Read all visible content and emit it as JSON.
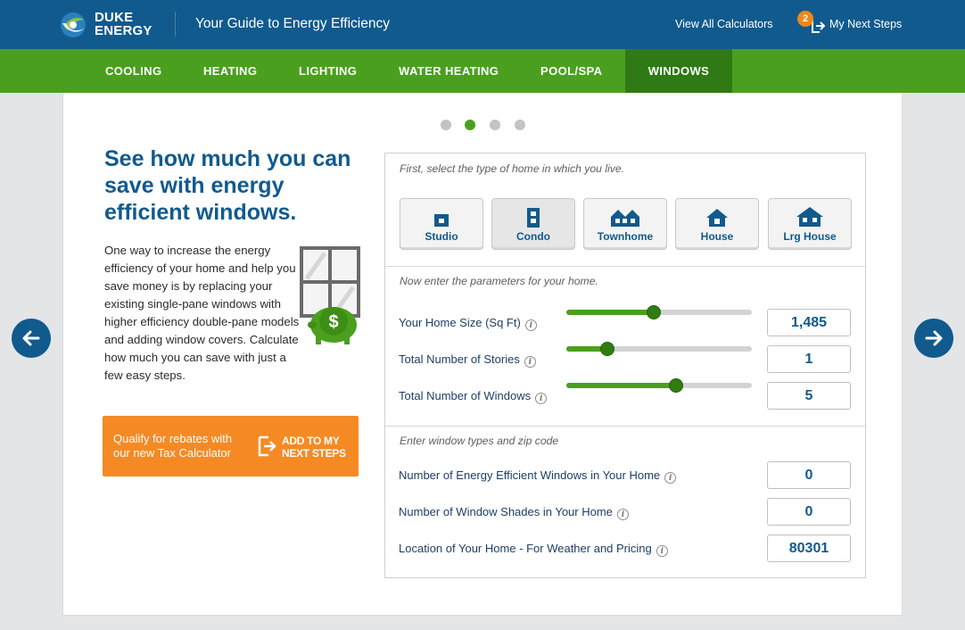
{
  "header": {
    "brand_line1": "DUKE",
    "brand_line2": "ENERGY",
    "title": "Your Guide to Energy Efficiency",
    "view_all": "View All Calculators",
    "next_steps_count": "2",
    "next_steps_label": "My Next Steps"
  },
  "nav": {
    "items": [
      "COOLING",
      "HEATING",
      "LIGHTING",
      "WATER HEATING",
      "POOL/SPA",
      "WINDOWS"
    ],
    "active": "WINDOWS"
  },
  "carousel": {
    "total": 4,
    "current": 2
  },
  "intro": {
    "headline": "See how much you can save with energy efficient windows.",
    "body": "One way to increase the energy efficiency of your home and help you save money is by replacing your existing single-pane windows with higher efficiency double-pane models and adding window covers. Calculate how much you can save with just a few easy steps."
  },
  "cta": {
    "text": "Qualify for rebates with our new Tax Calculator",
    "action": "ADD TO MY NEXT STEPS"
  },
  "calculator": {
    "step1_title": "First, select the type of home in which you live.",
    "home_types": [
      "Studio",
      "Condo",
      "Townhome",
      "House",
      "Lrg House"
    ],
    "selected_home": "Condo",
    "step2_title": "Now enter the parameters for your home.",
    "params": [
      {
        "label": "Your Home Size (Sq Ft)",
        "value": "1,485",
        "fill": 0.47
      },
      {
        "label": "Total Number of Stories",
        "value": "1",
        "fill": 0.22
      },
      {
        "label": "Total Number of Windows",
        "value": "5",
        "fill": 0.59
      }
    ],
    "step3_title": "Enter window types and zip code",
    "extras": [
      {
        "label": "Number of Energy Efficient Windows in Your Home",
        "value": "0"
      },
      {
        "label": "Number of Window Shades in Your Home",
        "value": "0"
      },
      {
        "label": "Location of Your Home - For Weather and Pricing",
        "value": "80301"
      }
    ]
  },
  "colors": {
    "brand_blue": "#115a8e",
    "nav_green": "#4aa01e",
    "nav_active": "#2f7a14",
    "cta_orange": "#f58a24"
  },
  "icons": {
    "prev": "arrow-left-icon",
    "next": "arrow-right-icon",
    "info": "info-icon",
    "add": "add-to-steps-icon"
  }
}
